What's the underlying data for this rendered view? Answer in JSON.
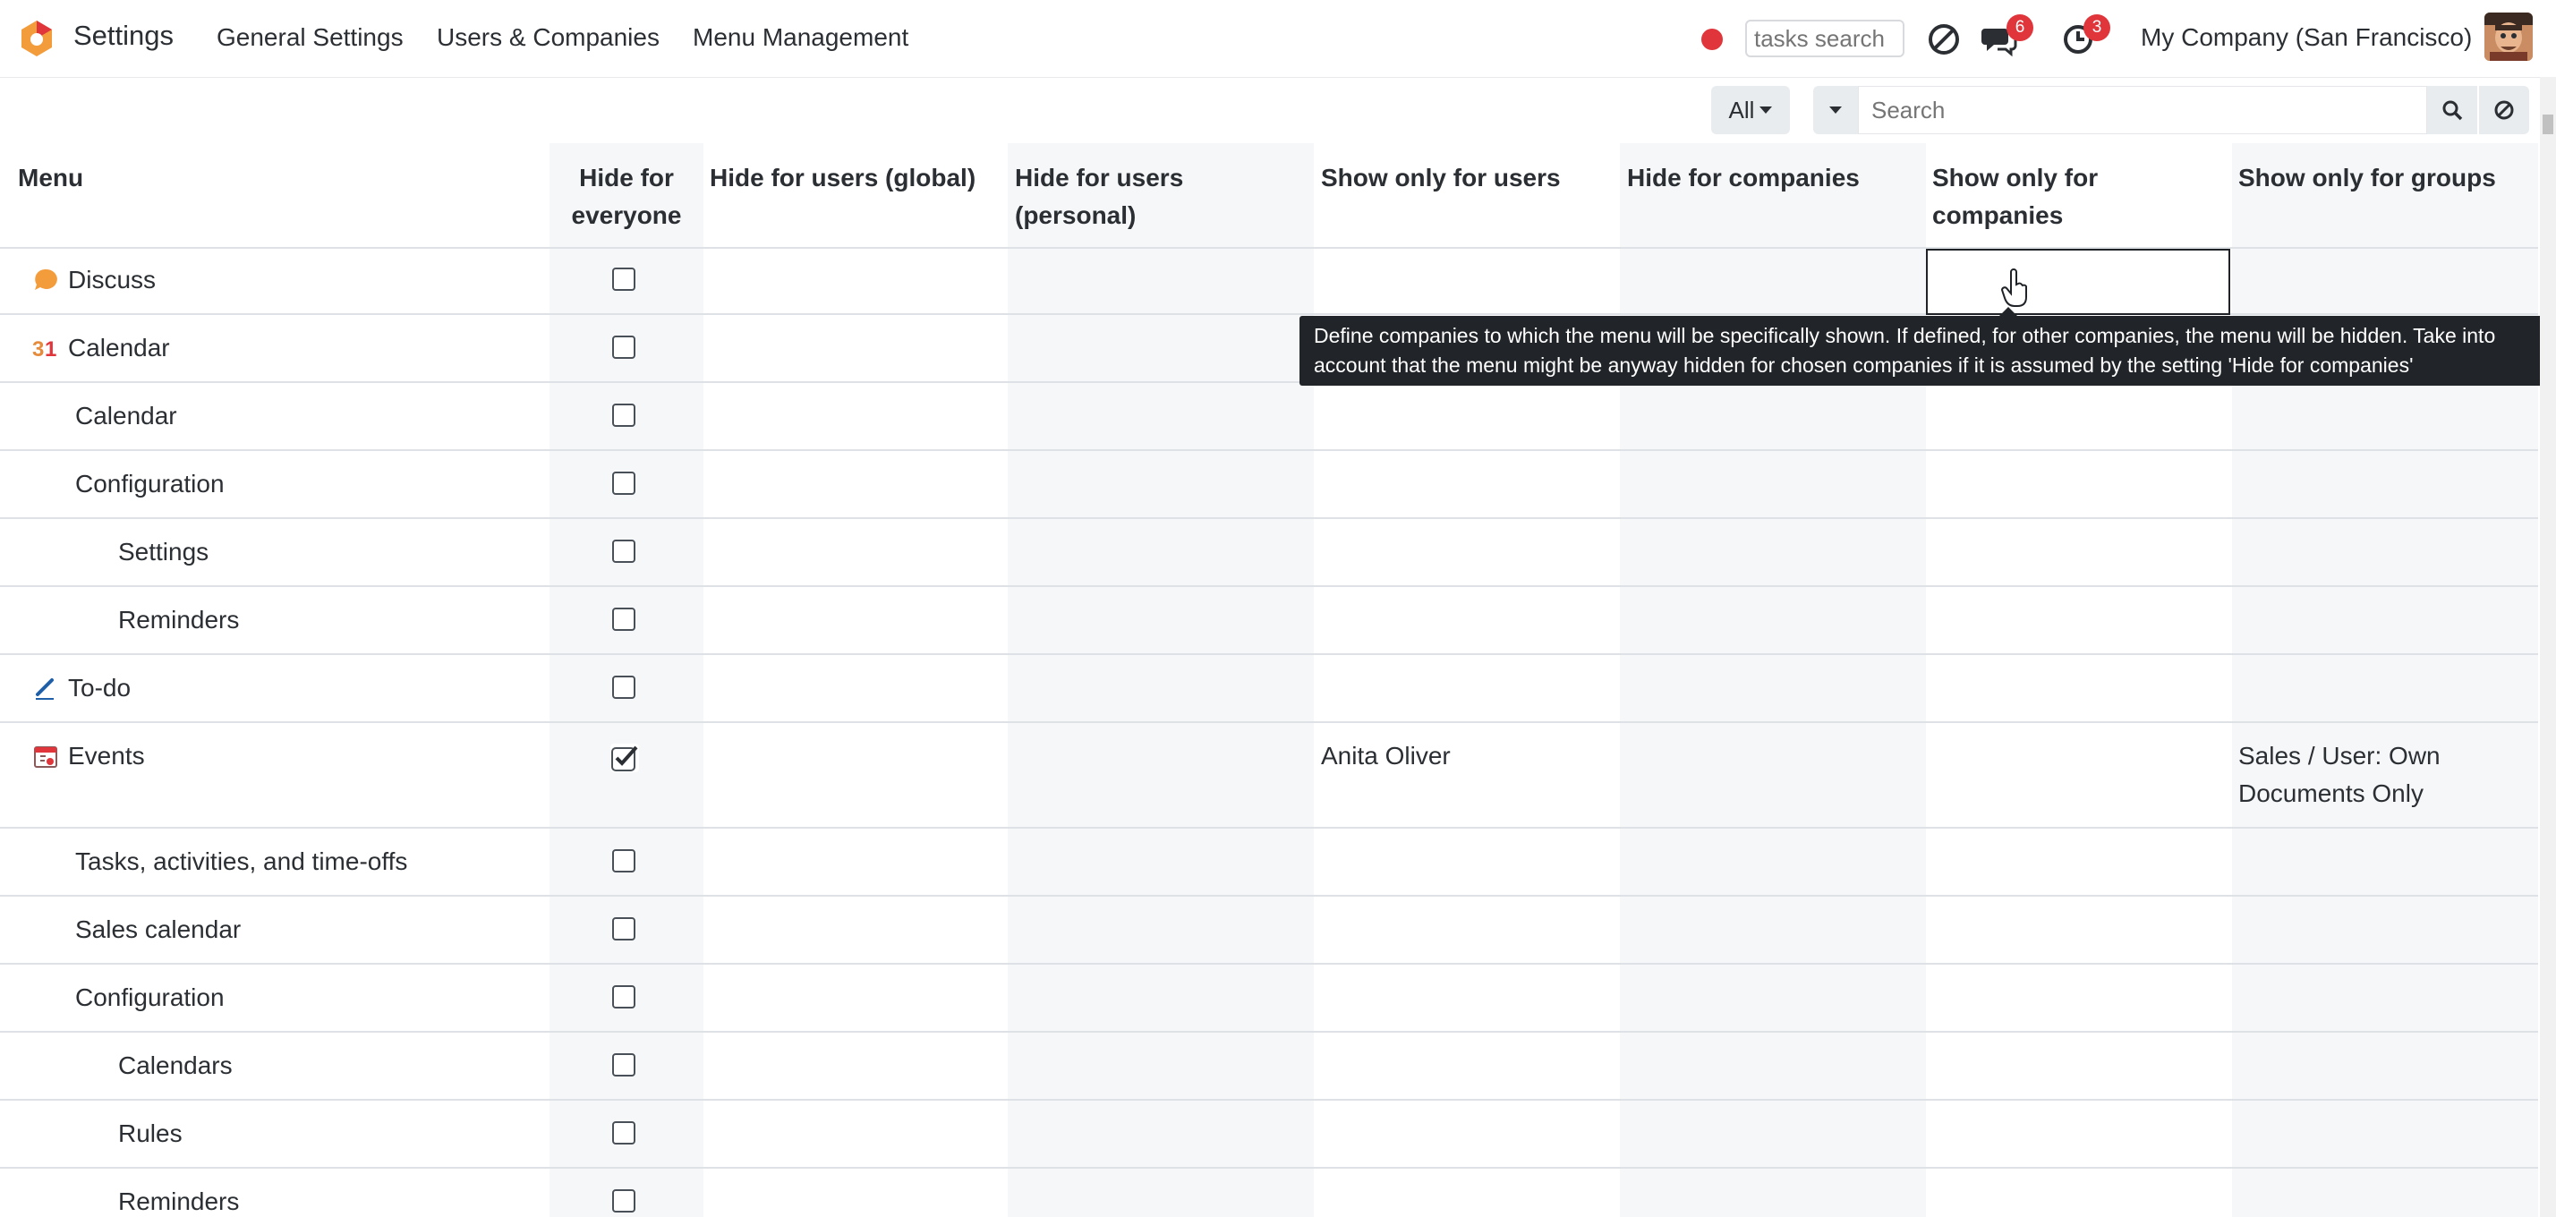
{
  "navbar": {
    "app_title": "Settings",
    "menus": [
      "General Settings",
      "Users & Companies",
      "Menu Management"
    ],
    "tasks_search_placeholder": "tasks search",
    "messages_badge": "6",
    "activities_badge": "3",
    "company": "My Company (San Francisco)"
  },
  "controls": {
    "filter_label": "All",
    "search_placeholder": "Search"
  },
  "table": {
    "headers": {
      "menu": "Menu",
      "hide_everyone_1": "Hide for",
      "hide_everyone_2": "everyone",
      "hide_users_global": "Hide for users (global)",
      "hide_users_personal_1": "Hide for users",
      "hide_users_personal_2": "(personal)",
      "show_users": "Show only for users",
      "hide_companies": "Hide for companies",
      "show_companies_1": "Show only for",
      "show_companies_2": "companies",
      "show_groups": "Show only for groups"
    },
    "rows": [
      {
        "name": "Discuss",
        "indent": 0,
        "icon": "discuss-icon",
        "checked": false
      },
      {
        "name": "Calendar",
        "indent": 0,
        "icon": "calendar-app-icon",
        "checked": false
      },
      {
        "name": "Calendar",
        "indent": 1,
        "checked": false
      },
      {
        "name": "Configuration",
        "indent": 1,
        "checked": false
      },
      {
        "name": "Settings",
        "indent": 2,
        "checked": false
      },
      {
        "name": "Reminders",
        "indent": 2,
        "checked": false
      },
      {
        "name": "To-do",
        "indent": 0,
        "icon": "pencil-icon",
        "checked": false
      },
      {
        "name": "Events",
        "indent": 0,
        "icon": "events-icon",
        "checked": true,
        "show_users": "Anita Oliver",
        "show_groups_1": "Sales / User: Own",
        "show_groups_2": "Documents Only"
      },
      {
        "name": "Tasks, activities, and time-offs",
        "indent": 1,
        "checked": false
      },
      {
        "name": "Sales calendar",
        "indent": 1,
        "checked": false
      },
      {
        "name": "Configuration",
        "indent": 1,
        "checked": false
      },
      {
        "name": "Calendars",
        "indent": 2,
        "checked": false
      },
      {
        "name": "Rules",
        "indent": 2,
        "checked": false
      },
      {
        "name": "Reminders",
        "indent": 2,
        "checked": false
      }
    ]
  },
  "tooltip": {
    "line1": "Define companies to which the menu will be specifically shown. If defined, for other companies, the menu will be hidden. Take into",
    "line2": "account that the menu might be anyway hidden for chosen companies if it is assumed by the setting 'Hide for companies'"
  },
  "colors": {
    "accent": "#e0353b",
    "stripe": "#f6f7f9",
    "tooltip_bg": "#212529",
    "logo_orange": "#f39c3c"
  }
}
